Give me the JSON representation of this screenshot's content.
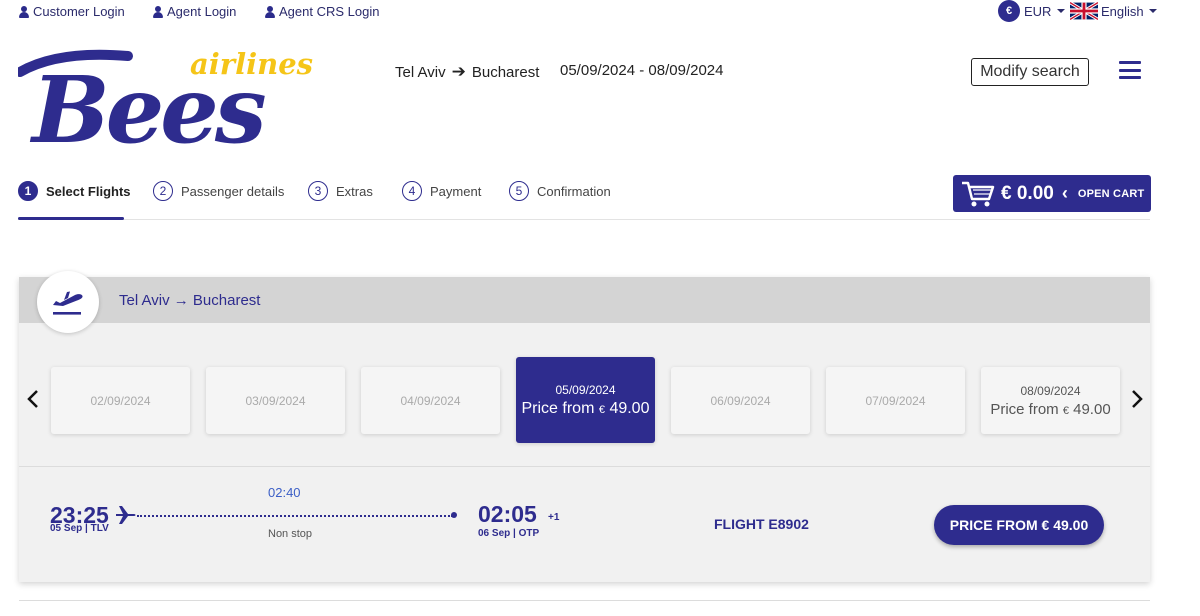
{
  "topbar": {
    "customer_login": "Customer Login",
    "agent_login": "Agent Login",
    "agent_crs_login": "Agent CRS Login",
    "currency_symbol": "€",
    "currency": "EUR",
    "language": "English"
  },
  "brand": {
    "logo_small": "airlines",
    "logo_big": "Bees",
    "primary_color": "#2e2c8e",
    "accent_color": "#f5c518"
  },
  "header": {
    "origin": "Tel Aviv",
    "arrow": "➔",
    "destination": "Bucharest",
    "dates": "05/09/2024 - 08/09/2024",
    "modify_label": "Modify search"
  },
  "steps": [
    {
      "num": "1",
      "label": "Select Flights"
    },
    {
      "num": "2",
      "label": "Passenger details"
    },
    {
      "num": "3",
      "label": "Extras"
    },
    {
      "num": "4",
      "label": "Payment"
    },
    {
      "num": "5",
      "label": "Confirmation"
    }
  ],
  "cart": {
    "amount": "€ 0.00",
    "chevron": "‹",
    "label": "OPEN CART"
  },
  "flight_card": {
    "route": "Tel Aviv → Bucharest",
    "dates": [
      {
        "date": "02/09/2024"
      },
      {
        "date": "03/09/2024"
      },
      {
        "date": "04/09/2024"
      },
      {
        "date": "05/09/2024",
        "price_prefix": "Price from",
        "currency": "€",
        "price": "49.00"
      },
      {
        "date": "06/09/2024"
      },
      {
        "date": "07/09/2024"
      },
      {
        "date": "08/09/2024",
        "price_prefix": "Price from",
        "currency": "€",
        "price": "49.00"
      }
    ],
    "flight": {
      "dep_time": "23:25",
      "dep_info": "05 Sep | TLV",
      "duration": "02:40",
      "stops": "Non stop",
      "arr_time": "02:05",
      "plus_day": "+1",
      "arr_info": "06 Sep | OTP",
      "flight_number": "FLIGHT E8902",
      "price_label": "PRICE FROM € 49.00"
    }
  }
}
